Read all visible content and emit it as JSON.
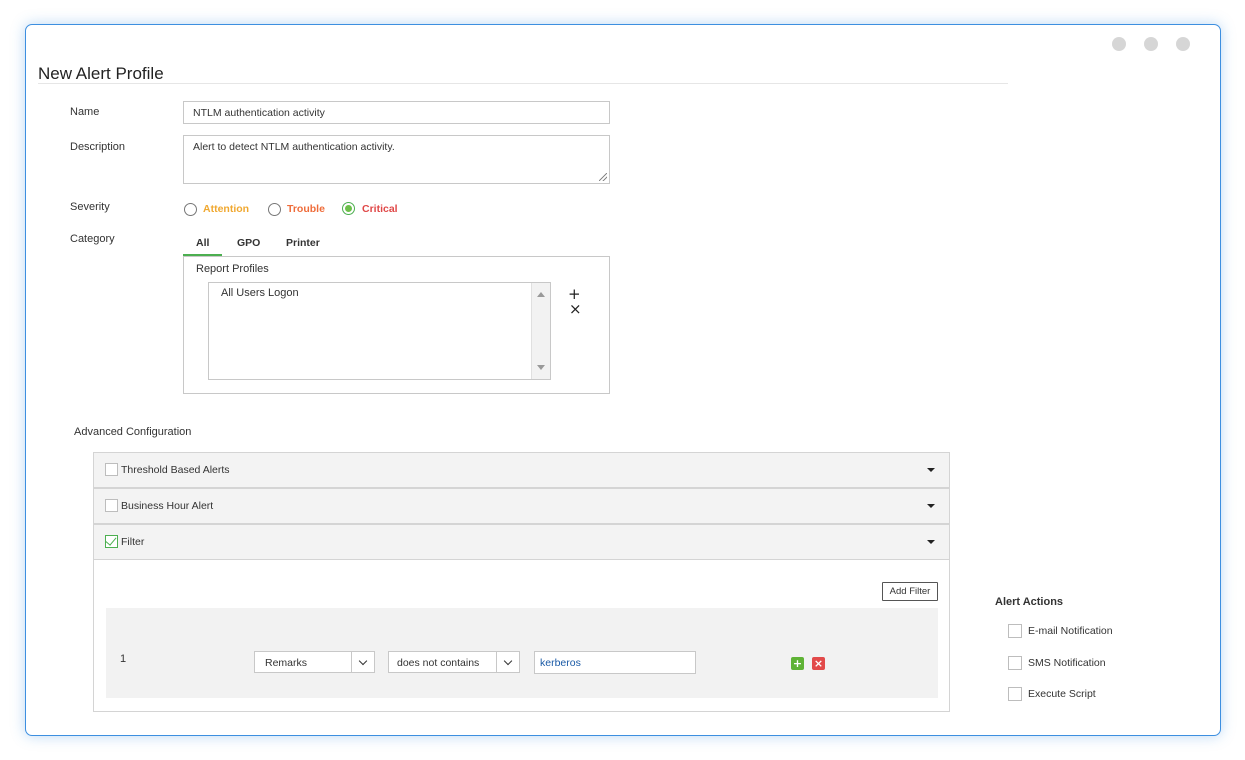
{
  "page": {
    "title": "New Alert Profile"
  },
  "form": {
    "name_label": "Name",
    "name_value": "NTLM authentication activity",
    "description_label": "Description",
    "description_value": "Alert to detect NTLM authentication activity.",
    "severity_label": "Severity",
    "severity_options": [
      {
        "label": "Attention",
        "color": "#f0a830",
        "checked": false
      },
      {
        "label": "Trouble",
        "color": "#ef6c3a",
        "checked": false
      },
      {
        "label": "Critical",
        "color": "#e04848",
        "checked": true
      }
    ],
    "category_label": "Category",
    "category_tabs": [
      {
        "label": "All",
        "active": true
      },
      {
        "label": "GPO",
        "active": false
      },
      {
        "label": "Printer",
        "active": false
      }
    ],
    "report_profiles_label": "Report Profiles",
    "report_profiles": [
      "All Users Logon"
    ],
    "add_symbol": "+",
    "remove_symbol": "×"
  },
  "advanced": {
    "label": "Advanced Configuration",
    "sections": [
      {
        "label": "Threshold Based Alerts",
        "checked": false
      },
      {
        "label": "Business Hour Alert",
        "checked": false
      },
      {
        "label": "Filter",
        "checked": true
      }
    ],
    "add_filter_label": "Add Filter",
    "filter_rows": [
      {
        "index": "1",
        "field": "Remarks",
        "operator": "does not contains",
        "value": "kerberos"
      }
    ]
  },
  "alert_actions": {
    "label": "Alert Actions",
    "items": [
      {
        "label": "E-mail Notification",
        "checked": false
      },
      {
        "label": "SMS Notification",
        "checked": false
      },
      {
        "label": "Execute Script",
        "checked": false
      }
    ]
  },
  "colors": {
    "accent": "#3d8fe0",
    "green": "#4caf50",
    "add_button": "#5fb336",
    "delete_button": "#e24a4a",
    "filter_value": "#1a5aa6"
  },
  "icons": [
    "plus-icon",
    "close-icon",
    "caret-down-icon",
    "chevron-down-icon",
    "check-icon",
    "resize-grip-icon"
  ]
}
